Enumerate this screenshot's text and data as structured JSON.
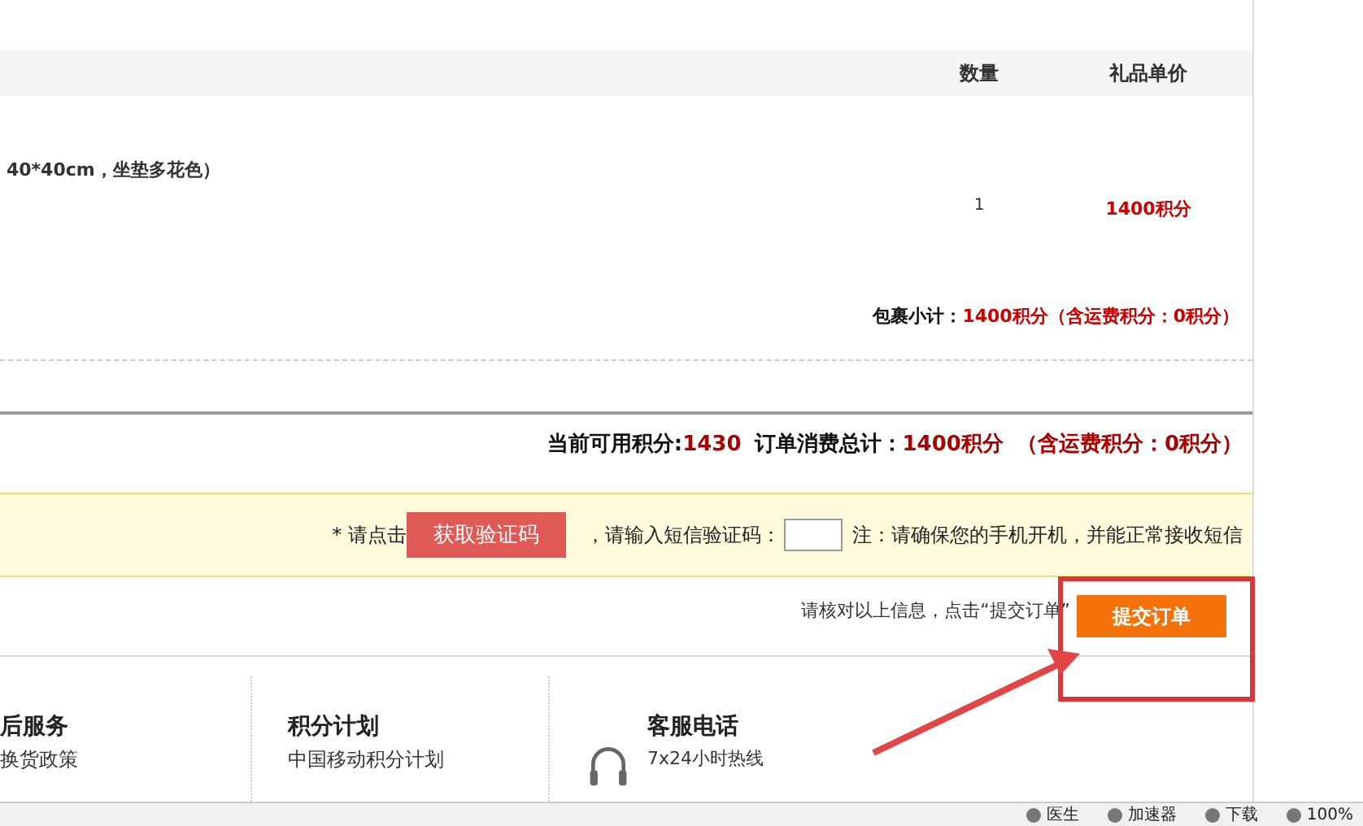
{
  "table": {
    "columns": [
      {
        "label": "数量"
      },
      {
        "label": "礼品单价"
      }
    ],
    "rows": [
      {
        "name": "40*40cm，坐垫多花色）",
        "quantity": "1",
        "price": "1400积分"
      }
    ],
    "subtotal": {
      "label": "包裹小计：",
      "value": "1400积分（含运费积分：0积分）"
    }
  },
  "summary": {
    "available_label": "当前可用积分:",
    "available": "1430",
    "total_label": "订单消费总计：",
    "total": "1400积分",
    "shipping": "（含运费积分：0积分）"
  },
  "verification": {
    "prefix": "* 请点击",
    "button": "获取验证码",
    "code_label": "，请输入短信验证码：",
    "note": "注：请确保您的手机开机，并能正常接收短信"
  },
  "submit": {
    "hint": "请核对以上信息，点击“提交订单”",
    "button": "提交订单"
  },
  "footer": [
    {
      "kind": "links",
      "title": "后服务",
      "items": [
        "换货政策"
      ]
    },
    {
      "kind": "links",
      "title": "积分计划",
      "items": [
        "中国移动积分计划"
      ]
    },
    {
      "kind": "phone",
      "title": "客服电话",
      "items": [
        "7x24小时热线"
      ]
    }
  ],
  "status_bar": [
    "医生",
    "加速器",
    "下载",
    "100%"
  ]
}
